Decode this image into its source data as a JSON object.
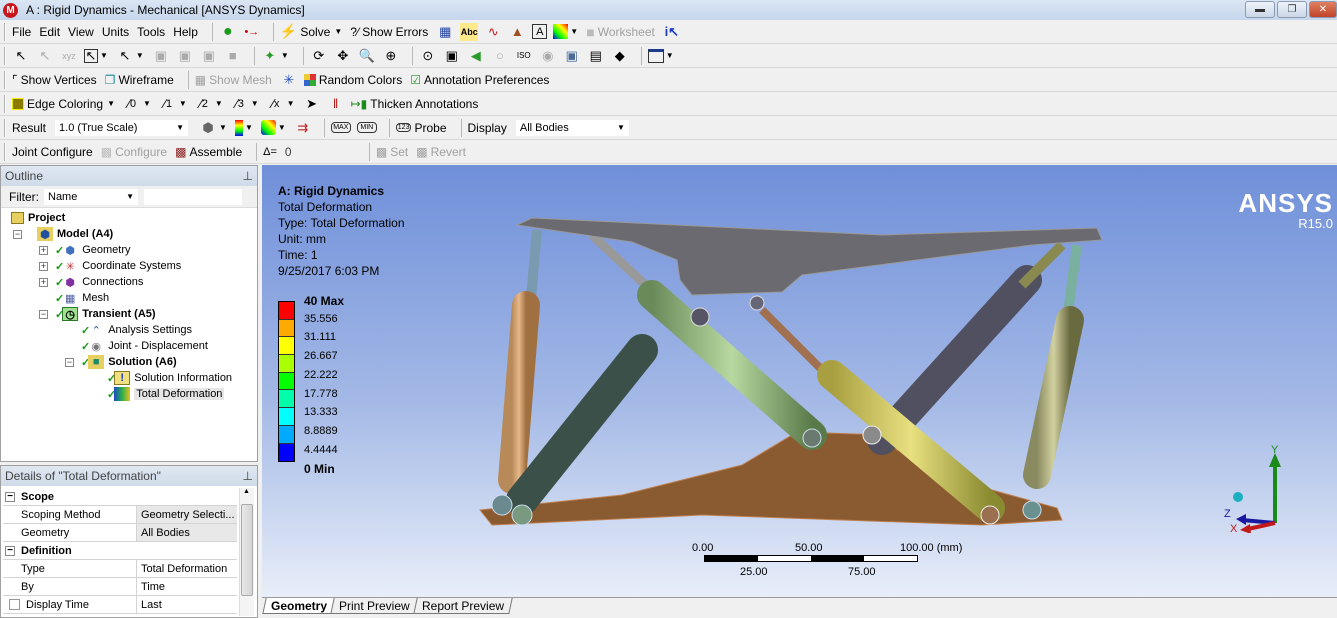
{
  "window": {
    "title": "A : Rigid Dynamics - Mechanical [ANSYS Dynamics]",
    "app_icon": "M",
    "buttons": [
      "minimize",
      "restore",
      "close"
    ]
  },
  "menu": {
    "items": [
      "File",
      "Edit",
      "View",
      "Units",
      "Tools",
      "Help"
    ],
    "solve_label": "Solve",
    "show_errors_label": "?⁄ Show Errors",
    "worksheet_label": "Worksheet"
  },
  "toolbar3": {
    "show_vertices": "Show Vertices",
    "wireframe": "Wireframe",
    "show_mesh": "Show Mesh",
    "random_colors": "Random Colors",
    "annotation_preferences": "Annotation Preferences"
  },
  "toolbar4": {
    "edge_coloring": "Edge Coloring",
    "thicken_annotations": "Thicken Annotations"
  },
  "toolbar5": {
    "result_label": "Result",
    "result_scale": "1.0 (True Scale)",
    "probe_label": "Probe",
    "display_label": "Display",
    "display_value": "All Bodies"
  },
  "toolbar6": {
    "joint_configure": "Joint Configure",
    "configure": "Configure",
    "assemble": "Assemble",
    "delta_label": "Δ=",
    "delta_value": "0",
    "set": "Set",
    "revert": "Revert"
  },
  "outline": {
    "title": "Outline",
    "filter_label": "Filter:",
    "filter_value": "Name",
    "search_value": "",
    "tree": [
      {
        "label": "Project",
        "bold": true
      },
      {
        "label": "Model (A4)",
        "bold": true
      },
      {
        "label": "Geometry"
      },
      {
        "label": "Coordinate Systems"
      },
      {
        "label": "Connections"
      },
      {
        "label": "Mesh"
      },
      {
        "label": "Transient (A5)",
        "bold": true
      },
      {
        "label": "Analysis Settings"
      },
      {
        "label": "Joint - Displacement"
      },
      {
        "label": "Solution (A6)",
        "bold": true
      },
      {
        "label": "Solution Information"
      },
      {
        "label": "Total Deformation",
        "selected": true
      }
    ]
  },
  "details": {
    "title": "Details of \"Total Deformation\"",
    "groups": [
      {
        "name": "Scope",
        "rows": [
          {
            "key": "Scoping Method",
            "value": "Geometry Selecti..."
          },
          {
            "key": "Geometry",
            "value": "All Bodies"
          }
        ]
      },
      {
        "name": "Definition",
        "rows": [
          {
            "key": "Type",
            "value": "Total Deformation"
          },
          {
            "key": "By",
            "value": "Time"
          },
          {
            "key": "Display Time",
            "value": "Last",
            "checkbox": true
          }
        ]
      }
    ]
  },
  "viewport": {
    "info": {
      "title": "A: Rigid Dynamics",
      "result": "Total Deformation",
      "type": "Type: Total Deformation",
      "unit": "Unit: mm",
      "time": "Time: 1",
      "date": "9/25/2017 6:03 PM"
    },
    "legend": {
      "labels": [
        "40 Max",
        "35.556",
        "31.111",
        "26.667",
        "22.222",
        "17.778",
        "13.333",
        "8.8889",
        "4.4444",
        "0 Min"
      ],
      "colors": [
        "#ff0000",
        "#ffaa00",
        "#ffff00",
        "#aaff00",
        "#00ff00",
        "#00ffaa",
        "#00ffff",
        "#00aaff",
        "#0000ff"
      ]
    },
    "brand": {
      "name": "ANSYS",
      "version": "R15.0"
    },
    "scale_bar": {
      "top_labels": [
        "0.00",
        "50.00",
        "100.00 (mm)"
      ],
      "bottom_labels": [
        "25.00",
        "75.00"
      ]
    },
    "axes": {
      "x": "X",
      "y": "Y",
      "z": "Z"
    }
  },
  "bottom_tabs": [
    {
      "label": "Geometry",
      "active": true
    },
    {
      "label": "Print Preview"
    },
    {
      "label": "Report Preview"
    }
  ]
}
